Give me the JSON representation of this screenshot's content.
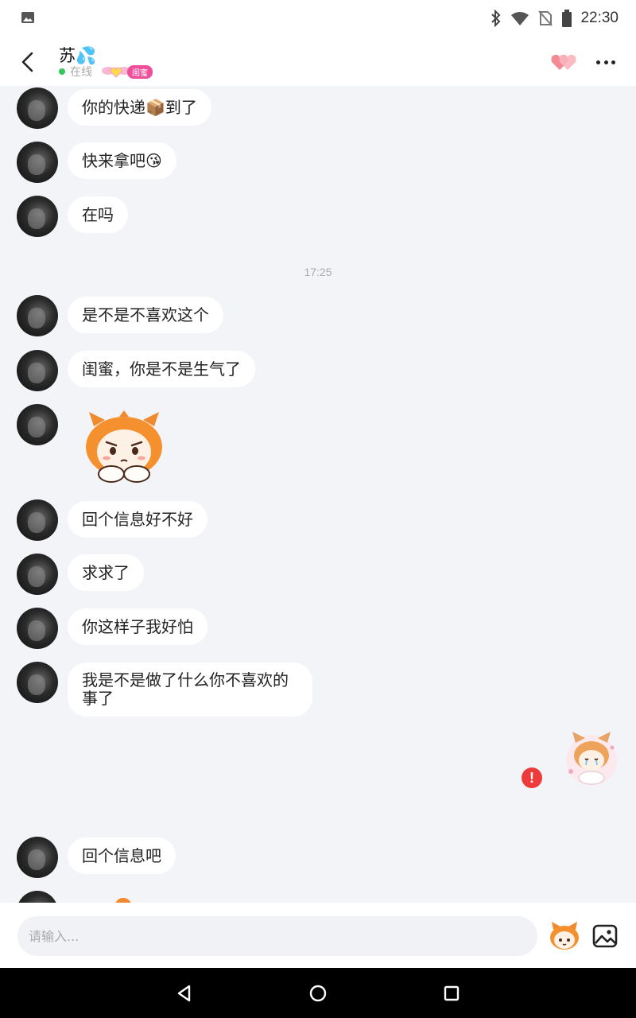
{
  "status_bar": {
    "time": "22:30",
    "icons": [
      "image-icon",
      "bluetooth-icon",
      "wifi-icon",
      "no-sim-icon",
      "battery-icon"
    ]
  },
  "header": {
    "contact_name": "苏💦",
    "online_status": "在线",
    "relation_tag": "闺蜜",
    "icons": [
      "back-icon",
      "hearts-icon",
      "more-icon"
    ]
  },
  "messages": [
    {
      "type": "text",
      "text": "你的快递📦到了"
    },
    {
      "type": "text",
      "text": "快来拿吧😘"
    },
    {
      "type": "text",
      "text": "在吗"
    },
    {
      "type": "timestamp",
      "text": "17:25"
    },
    {
      "type": "text",
      "text": "是不是不喜欢这个"
    },
    {
      "type": "text",
      "text": "闺蜜，你是不是生气了"
    },
    {
      "type": "sticker",
      "sticker": "sad-fox-girl-sticker"
    },
    {
      "type": "text",
      "text": "回个信息好不好"
    },
    {
      "type": "text",
      "text": "求求了"
    },
    {
      "type": "text",
      "text": "你这样子我好怕"
    },
    {
      "type": "text",
      "text": "我是不是做了什么你不喜欢的事了"
    },
    {
      "type": "sticker",
      "sender": "me",
      "sticker": "crying-fox-girl-sticker",
      "status": "failed"
    },
    {
      "type": "text",
      "text": "回个信息吧"
    }
  ],
  "input": {
    "placeholder": "请输入..."
  },
  "colors": {
    "accent_pink": "#f04e9b",
    "error_red": "#ee3a3a",
    "online_green": "#34c759",
    "chat_background": "#f3f4f8"
  }
}
